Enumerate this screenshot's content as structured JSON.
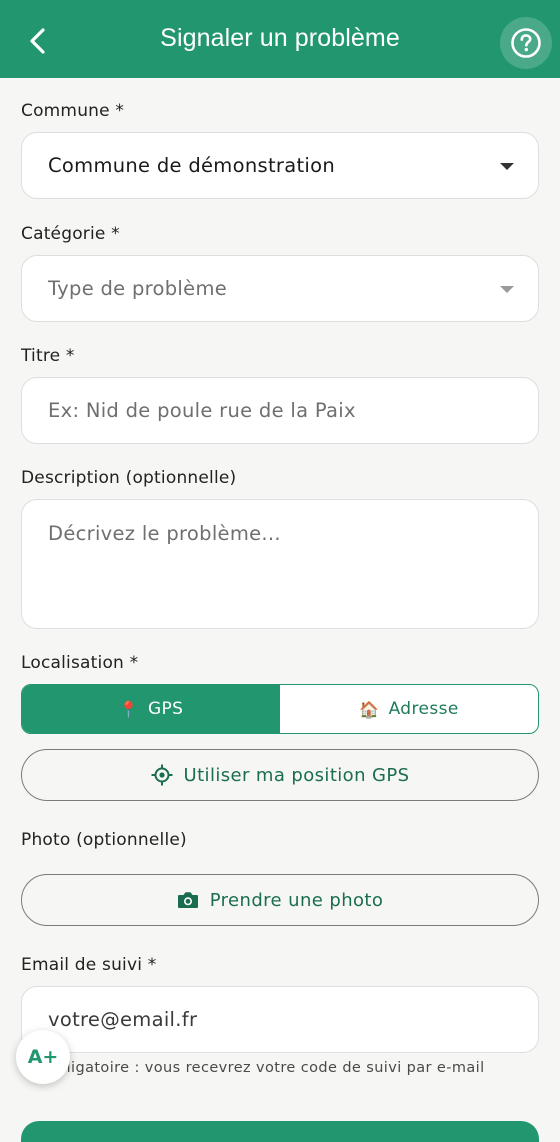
{
  "header": {
    "title": "Signaler un problème",
    "back_icon": "chevron-left-icon",
    "help_icon": "help-circle-icon",
    "background_color": "#22976f"
  },
  "form": {
    "commune": {
      "label": "Commune *",
      "value": "Commune de démonstration"
    },
    "categorie": {
      "label": "Catégorie *",
      "placeholder": "Type de problème"
    },
    "titre": {
      "label": "Titre *",
      "placeholder": "Ex: Nid de poule rue de la Paix"
    },
    "description": {
      "label": "Description (optionnelle)",
      "placeholder": "Décrivez le problème..."
    },
    "localisation": {
      "label": "Localisation *",
      "options": [
        {
          "icon": "📍",
          "label": "GPS",
          "active": true
        },
        {
          "icon": "🏠",
          "label": "Adresse",
          "active": false
        }
      ],
      "gps_button": "Utiliser ma position GPS"
    },
    "photo": {
      "label": "Photo (optionnelle)",
      "button": "Prendre une photo"
    },
    "email": {
      "label": "Email de suivi *",
      "placeholder": "votre@email.fr",
      "hint": "bligatoire : vous recevrez votre code de suivi par e-mail"
    }
  },
  "accessibility_button": {
    "label": "A+"
  },
  "colors": {
    "accent": "#22976f",
    "accent_text": "#1b6d51",
    "background": "#f6f6f4"
  }
}
